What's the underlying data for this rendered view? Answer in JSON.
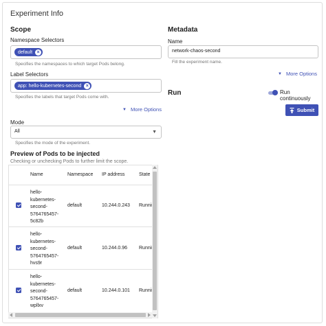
{
  "card": {
    "title": "Experiment Info"
  },
  "scope": {
    "heading": "Scope",
    "namespace": {
      "label": "Namespace Selectors",
      "chip": "default",
      "helper": "Specifies the namespaces to which target Pods belong."
    },
    "labels": {
      "label": "Label Selectors",
      "chip": "app: hello-kubernetes-second",
      "helper": "Specifies the labels that target Pods come with."
    },
    "more_options": "More Options",
    "mode": {
      "label": "Mode",
      "value": "All",
      "helper": "Specifies the mode of the experiment."
    }
  },
  "preview": {
    "heading": "Preview of Pods to be injected",
    "subtitle": "Checking or unchecking Pods to further limit the scope.",
    "columns": [
      "Name",
      "Namespace",
      "IP address",
      "State"
    ],
    "rows": [
      {
        "name": [
          "hello-",
          "kubernetes-",
          "second-",
          "5764765457-",
          "5c82b"
        ],
        "namespace": "default",
        "ip": "10.244.0.243",
        "state": "Running"
      },
      {
        "name": [
          "hello-",
          "kubernetes-",
          "second-",
          "5764765457-",
          "hvs9r"
        ],
        "namespace": "default",
        "ip": "10.244.0.96",
        "state": "Running"
      },
      {
        "name": [
          "hello-",
          "kubernetes-",
          "second-",
          "5764765457-",
          "wpllxv"
        ],
        "namespace": "default",
        "ip": "10.244.0.101",
        "state": "Running"
      }
    ]
  },
  "metadata": {
    "heading": "Metadata",
    "name": {
      "label": "Name",
      "value": "network-chaos-second",
      "helper": "Fill the experiment name."
    },
    "more_options": "More Options"
  },
  "run": {
    "heading": "Run",
    "toggle_label": "Run continuously",
    "submit_label": "Submit"
  },
  "colors": {
    "primary": "#3f51b5",
    "border": "#c4c4c4"
  }
}
